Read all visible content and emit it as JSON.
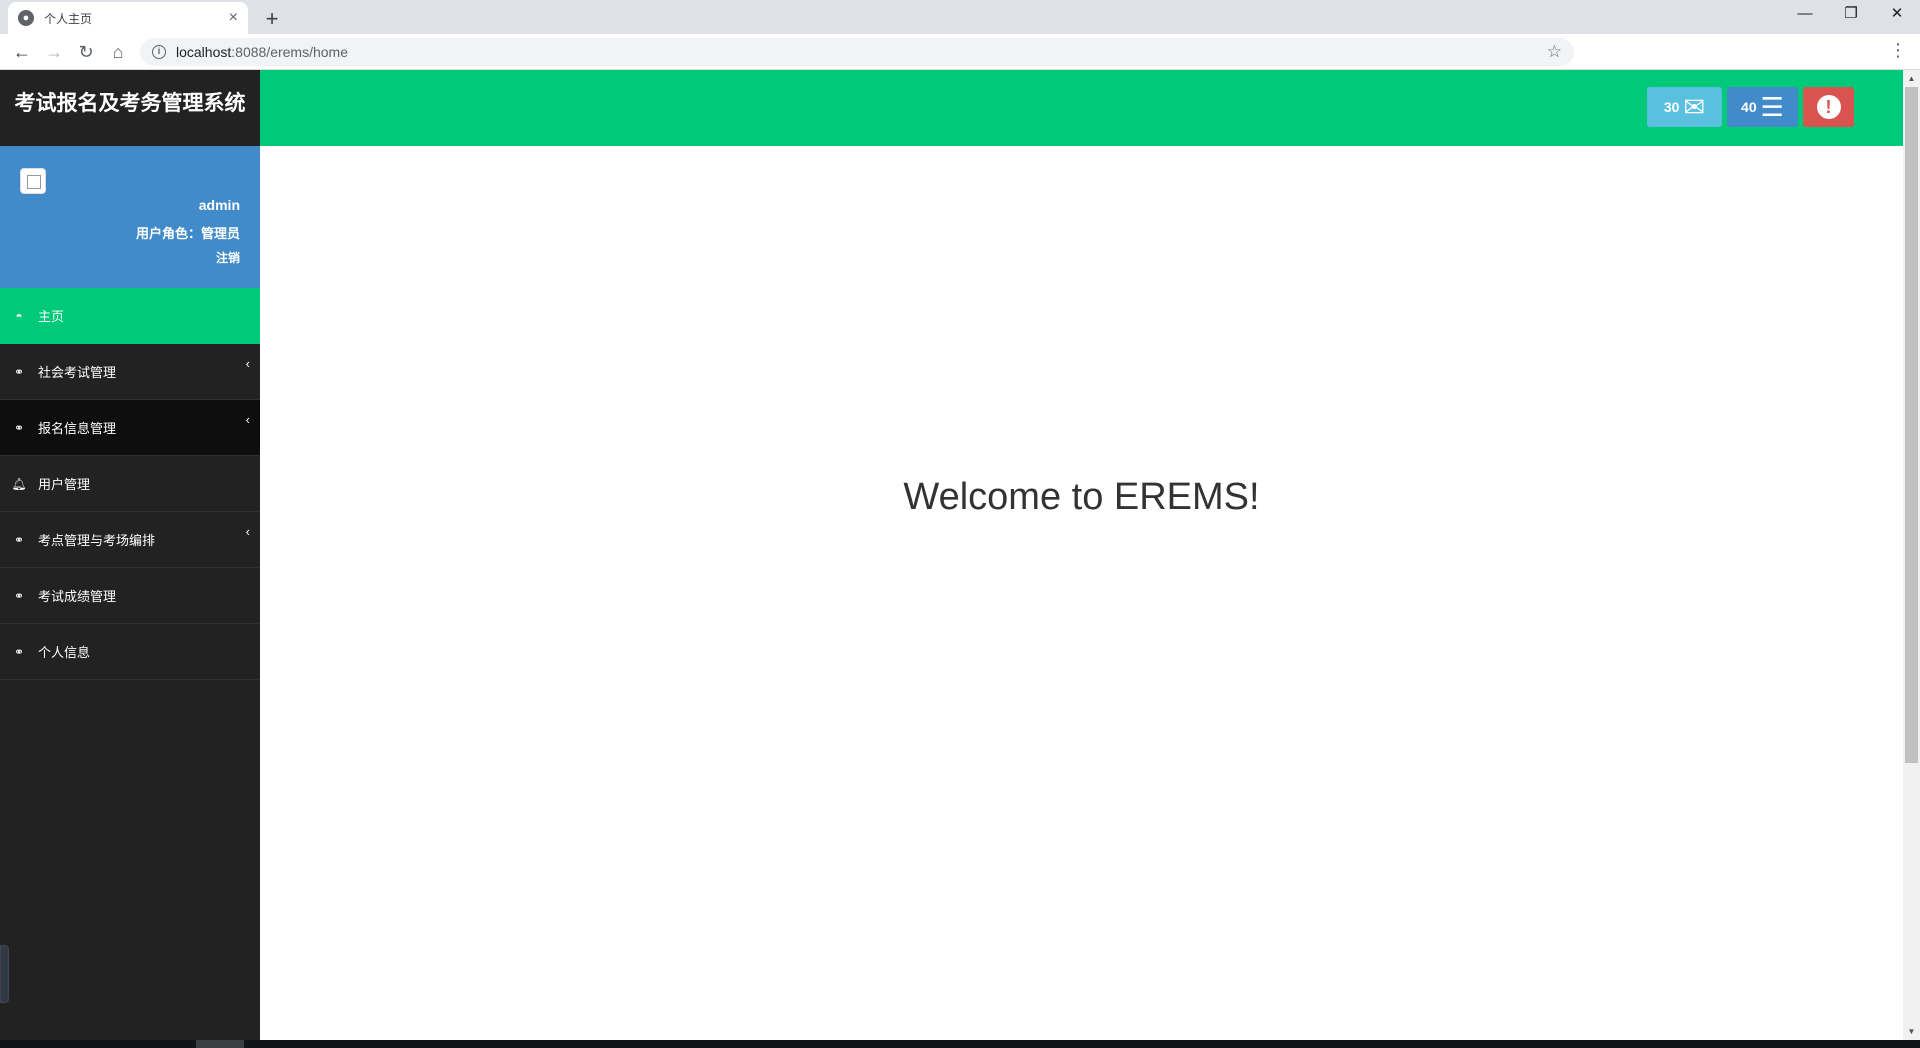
{
  "browser": {
    "tab_title": "个人主页",
    "url_host": "localhost",
    "url_path": ":8088/erems/home",
    "new_tab": "+",
    "icons": {
      "back": "arrow-left-icon",
      "forward": "arrow-right-icon",
      "reload": "reload-icon",
      "home": "home-icon",
      "info": "info-icon",
      "star": "star-icon",
      "menu": "more-vert-icon"
    }
  },
  "sidebar": {
    "brand": "考试报名及考务管理系统",
    "profile": {
      "username": "admin",
      "role_label": "用户角色：",
      "role": "管理员",
      "logout": "注销"
    },
    "items": [
      {
        "label": "主页",
        "icon": "dashboard-icon",
        "has_submenu": false,
        "active": true
      },
      {
        "label": "社会考试管理",
        "icon": "bicycle-icon",
        "has_submenu": true
      },
      {
        "label": "报名信息管理",
        "icon": "bicycle-icon",
        "has_submenu": true
      },
      {
        "label": "用户管理",
        "icon": "bell-icon",
        "has_submenu": false
      },
      {
        "label": "考点管理与考场编排",
        "icon": "bicycle-icon",
        "has_submenu": true
      },
      {
        "label": "考试成绩管理",
        "icon": "bicycle-icon",
        "has_submenu": false
      },
      {
        "label": "个人信息",
        "icon": "bicycle-icon",
        "has_submenu": false
      }
    ]
  },
  "topbar": {
    "messages_count": "30",
    "tasks_count": "40",
    "colors": {
      "bar": "#00ca79",
      "messages": "#5bc0de",
      "tasks": "#428bca",
      "alerts": "#d9534f"
    }
  },
  "main": {
    "welcome": "Welcome to EREMS!"
  }
}
